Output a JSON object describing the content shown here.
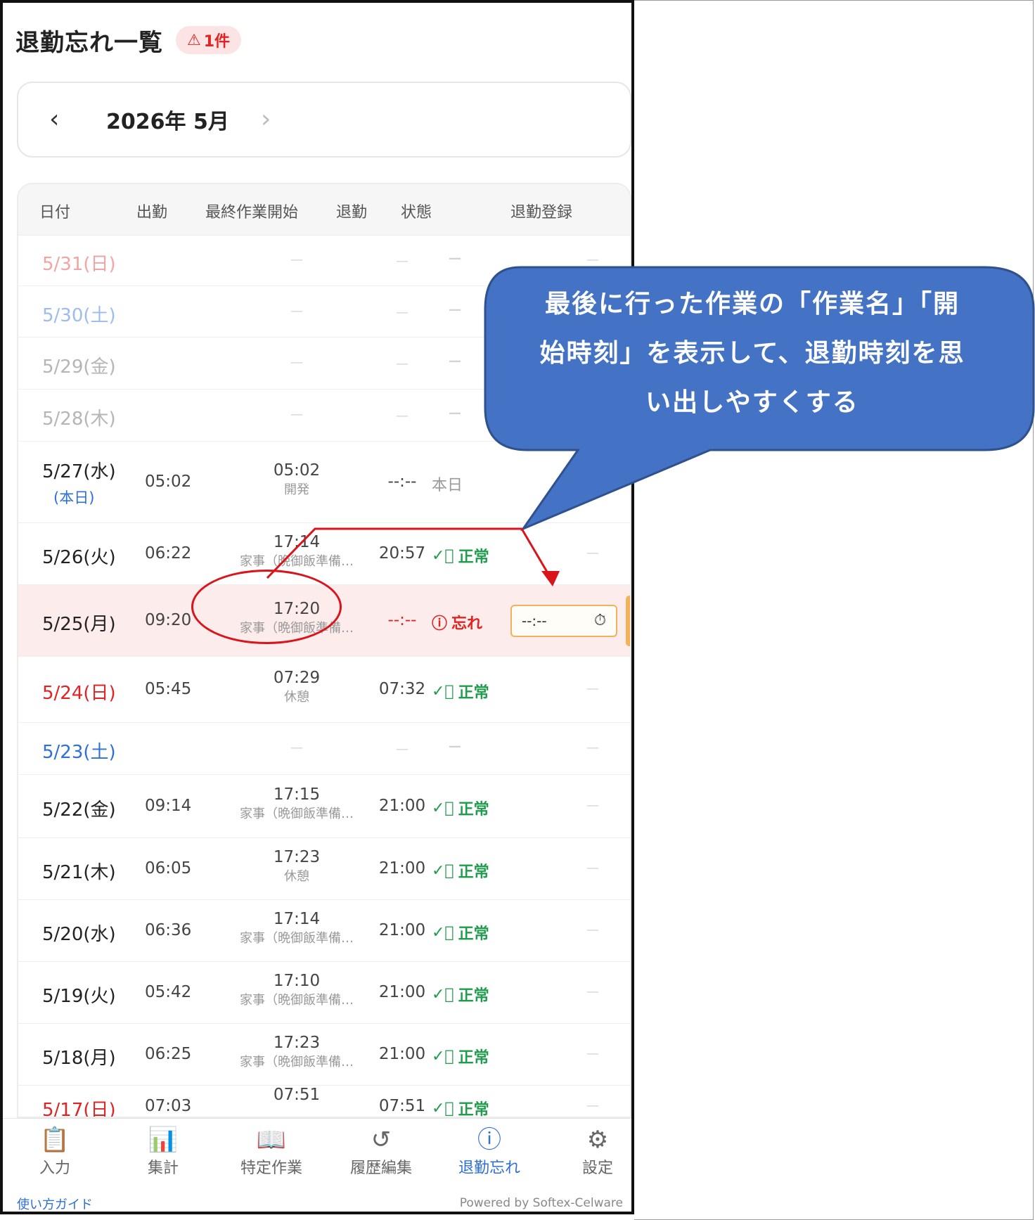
{
  "header": {
    "title": "退勤忘れ一覧",
    "badge_count": "1件"
  },
  "month_nav": {
    "prev": "‹",
    "label": "2026年 5月",
    "next": "›"
  },
  "table": {
    "columns": [
      "日付",
      "出勤",
      "最終作業開始",
      "退勤",
      "状態",
      "退勤登録"
    ],
    "rows": [
      {
        "date": "5/31(日)",
        "day_type": "sun",
        "faded": true,
        "clock_in": "",
        "last_time": "",
        "last_task": "",
        "clock_out": "",
        "status": "",
        "reg": "—"
      },
      {
        "date": "5/30(土)",
        "day_type": "sat",
        "faded": true,
        "clock_in": "",
        "last_time": "",
        "last_task": "",
        "clock_out": "",
        "status": "",
        "reg": "—"
      },
      {
        "date": "5/29(金)",
        "day_type": "weekday",
        "faded": true,
        "clock_in": "",
        "last_time": "",
        "last_task": "",
        "clock_out": "",
        "status": "",
        "reg": "—"
      },
      {
        "date": "5/28(木)",
        "day_type": "weekday",
        "faded": true,
        "clock_in": "",
        "last_time": "",
        "last_task": "",
        "clock_out": "",
        "status": "",
        "reg": "—"
      },
      {
        "date": "5/27(水)",
        "today_label": "(本日)",
        "day_type": "weekday",
        "clock_in": "05:02",
        "last_time": "05:02",
        "last_task": "開発",
        "clock_out": "--:--",
        "status": "本日",
        "status_type": "today",
        "reg": ""
      },
      {
        "date": "5/26(火)",
        "day_type": "weekday",
        "clock_in": "06:22",
        "last_time": "17:14",
        "last_task": "家事（晩御飯準備…",
        "clock_out": "20:57",
        "status": "正常",
        "status_type": "ok",
        "reg": "—"
      },
      {
        "date": "5/25(月)",
        "day_type": "weekday",
        "forgot": true,
        "clock_in": "09:20",
        "last_time": "17:20",
        "last_task": "家事（晩御飯準備…",
        "clock_out": "--:--",
        "status": "忘れ",
        "status_type": "ng",
        "reg_input": "--:--"
      },
      {
        "date": "5/24(日)",
        "day_type": "sun",
        "clock_in": "05:45",
        "last_time": "07:29",
        "last_task": "休憩",
        "clock_out": "07:32",
        "status": "正常",
        "status_type": "ok",
        "reg": "—"
      },
      {
        "date": "5/23(土)",
        "day_type": "sat",
        "clock_in": "",
        "last_time": "",
        "last_task": "",
        "clock_out": "",
        "status": "",
        "reg": "—"
      },
      {
        "date": "5/22(金)",
        "day_type": "weekday",
        "clock_in": "09:14",
        "last_time": "17:15",
        "last_task": "家事（晩御飯準備…",
        "clock_out": "21:00",
        "status": "正常",
        "status_type": "ok",
        "reg": "—"
      },
      {
        "date": "5/21(木)",
        "day_type": "weekday",
        "clock_in": "06:05",
        "last_time": "17:23",
        "last_task": "休憩",
        "clock_out": "21:00",
        "status": "正常",
        "status_type": "ok",
        "reg": "—"
      },
      {
        "date": "5/20(水)",
        "day_type": "weekday",
        "clock_in": "06:36",
        "last_time": "17:14",
        "last_task": "家事（晩御飯準備…",
        "clock_out": "21:00",
        "status": "正常",
        "status_type": "ok",
        "reg": "—"
      },
      {
        "date": "5/19(火)",
        "day_type": "weekday",
        "clock_in": "05:42",
        "last_time": "17:10",
        "last_task": "家事（晩御飯準備…",
        "clock_out": "21:00",
        "status": "正常",
        "status_type": "ok",
        "reg": "—"
      },
      {
        "date": "5/18(月)",
        "day_type": "weekday",
        "clock_in": "06:25",
        "last_time": "17:23",
        "last_task": "家事（晩御飯準備…",
        "clock_out": "21:00",
        "status": "正常",
        "status_type": "ok",
        "reg": "—"
      },
      {
        "date": "5/17(日)",
        "day_type": "sun",
        "clock_in": "07:03",
        "last_time": "07:51",
        "last_task": "",
        "clock_out": "07:51",
        "status": "正常",
        "status_type": "ok",
        "reg": "—"
      }
    ]
  },
  "bottom_nav": [
    {
      "label": "入力",
      "icon": "clipboard-icon",
      "active": false
    },
    {
      "label": "集計",
      "icon": "bar-chart-icon",
      "active": false
    },
    {
      "label": "特定作業",
      "icon": "book-icon",
      "active": false
    },
    {
      "label": "履歴編集",
      "icon": "history-icon",
      "active": false
    },
    {
      "label": "退勤忘れ",
      "icon": "alert-circle-icon",
      "active": true
    },
    {
      "label": "設定",
      "icon": "gear-icon",
      "active": false
    }
  ],
  "footer": {
    "guide_link": "使い方ガイド",
    "powered_by": "Powered by Softex-Celware"
  },
  "callout": {
    "text_lines": [
      "最後に行った作業の「作業名」「開",
      "始時刻」を表示して、退勤時刻を思",
      "い出しやすくする"
    ]
  },
  "colors": {
    "accent": "#2f6fd8",
    "alert_red": "#e02424",
    "ok_green": "#1f9d4c",
    "callout_fill": "#4472c4",
    "annotation_red": "#d9141b",
    "input_border": "#f3b15a"
  }
}
